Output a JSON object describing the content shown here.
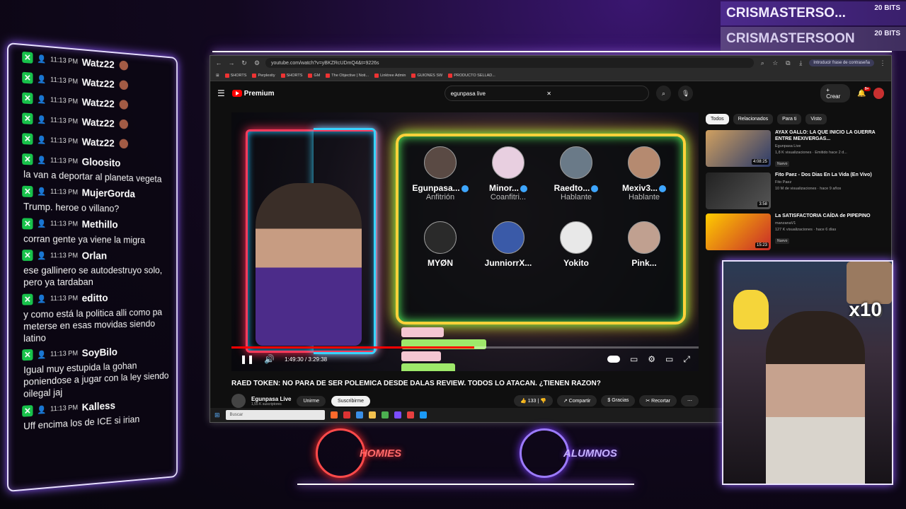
{
  "bits": [
    {
      "name": "CRISMASTERSO...",
      "amount": "20 BITS"
    },
    {
      "name": "CRISMASTERSOON",
      "amount": "20 BITS"
    }
  ],
  "chat": [
    {
      "time": "11:13 PM",
      "user": "Watz22",
      "text": ""
    },
    {
      "time": "11:13 PM",
      "user": "Watz22",
      "text": ""
    },
    {
      "time": "11:13 PM",
      "user": "Watz22",
      "text": ""
    },
    {
      "time": "11:13 PM",
      "user": "Watz22",
      "text": ""
    },
    {
      "time": "11:13 PM",
      "user": "Watz22",
      "text": ""
    },
    {
      "time": "11:13 PM",
      "user": "Gloosito",
      "text": "la van a deportar al planeta vegeta"
    },
    {
      "time": "11:13 PM",
      "user": "MujerGorda",
      "text": "Trump. heroe o villano?"
    },
    {
      "time": "11:13 PM",
      "user": "Methillo",
      "text": "corran gente ya viene la migra"
    },
    {
      "time": "11:13 PM",
      "user": "Orlan",
      "text": "ese gallinero se autodestruyo solo, pero ya tardaban"
    },
    {
      "time": "11:13 PM",
      "user": "editto",
      "text": "y como está la politica alli como pa meterse en esas movidas siendo latino"
    },
    {
      "time": "11:13 PM",
      "user": "SoyBilo",
      "text": "Igual muy estupida la gohan poniendose a jugar con la ley siendo oilegal jaj"
    },
    {
      "time": "11:13 PM",
      "user": "Kalless",
      "text": "Uff encima los de ICE si irian"
    }
  ],
  "browser": {
    "url": "youtube.com/watch?v=yBKZRcUDmQ4&t=9226s",
    "password_hint": "Introducir frase de contraseña",
    "bookmarks": [
      "SHORTS",
      "Perplexity",
      "SHORTS",
      "GM",
      "The Objective | Noti...",
      "Linktree Admin",
      "GUIONES SW",
      "PRODUCTO SELLAD..."
    ]
  },
  "youtube": {
    "logo": "Premium",
    "search_value": "egunpasa live",
    "create_label": "Crear",
    "notif_count": "9+",
    "participants": [
      {
        "name": "Egunpasa...",
        "role": "Anfitrión",
        "verified": true
      },
      {
        "name": "Minor...",
        "role": "Coanfitri...",
        "verified": true
      },
      {
        "name": "Raedto...",
        "role": "Hablante",
        "verified": true
      },
      {
        "name": "Mexiv3...",
        "role": "Hablante",
        "verified": true
      },
      {
        "name": "MYØN",
        "role": "",
        "verified": false
      },
      {
        "name": "JunniorrX...",
        "role": "",
        "verified": false
      },
      {
        "name": "Yokito",
        "role": "",
        "verified": false
      },
      {
        "name": "Pink...",
        "role": "",
        "verified": false
      }
    ],
    "time_display": "1:49:30 / 3:29:38",
    "progress": 0.52,
    "video_title": "RAED TOKEN: NO PARA DE SER POLEMICA DESDE DALAS REVIEW. TODOS LO ATACAN. ¿TIENEN RAZON?",
    "channel": {
      "name": "Egunpasa Live",
      "subs": "1,55 K suscriptores"
    },
    "join_label": "Unirme",
    "subscribe_label": "Suscribirme",
    "likes": "133",
    "share_label": "Compartir",
    "thanks_label": "Gracias",
    "clip_label": "Recortar",
    "chips": [
      "Todos",
      "Relacionados",
      "Para ti",
      "Visto"
    ],
    "recs": [
      {
        "title": "AYAX GALLO: LA QUE INICIO LA GUERRA ENTRE MEXIVERGAS...",
        "channel": "Egunpasa Live",
        "meta": "1,8 K visualizaciones · Emitido hace 2 d...",
        "duration": "4:08:25",
        "badge": "Nuevo"
      },
      {
        "title": "Fito Paez - Dos Dias En La Vida (En Vivo)",
        "channel": "Fito Paez",
        "meta": "10 M de visualizaciones · hace 9 años",
        "duration": "3:58",
        "badge": ""
      },
      {
        "title": "La SATISFACTORIA CAÍDA de PIPEPINO",
        "channel": "manzanaV1",
        "meta": "127 K visualizaciones · hace 6 días",
        "duration": "15:23",
        "badge": "Nuevo"
      }
    ],
    "taskbar_search": "Buscar"
  },
  "overlay": {
    "logo_left": "HOMIES",
    "logo_right": "ALUMNOS",
    "cam_multiplier": "x10"
  }
}
